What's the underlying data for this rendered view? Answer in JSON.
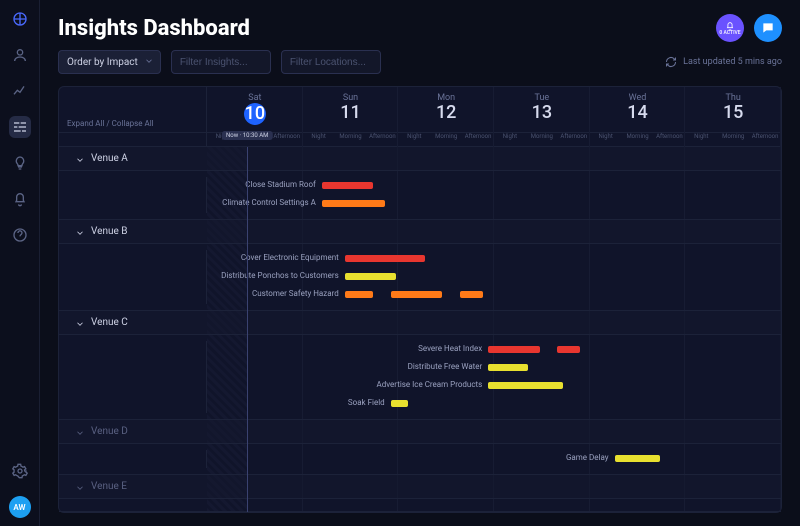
{
  "app": {
    "title": "Insights Dashboard"
  },
  "header_icons": {
    "notif_label": "0 ACTIVE"
  },
  "controls": {
    "order_label": "Order by Impact",
    "filter_insights_ph": "Filter Insights...",
    "filter_locations_ph": "Filter Locations...",
    "refresh_label": "Last updated 5 mins ago"
  },
  "timeline": {
    "expand_label": "Expand All / Collapse All",
    "now_label": "Now",
    "now_time": "10:30 AM",
    "subslots": [
      "Night",
      "Morning",
      "Afternoon",
      "Night",
      "Morning",
      "Afternoon",
      "Night",
      "Morning",
      "Afternoon",
      "Night",
      "Morning",
      "Afternoon",
      "Night",
      "Morning",
      "Afternoon",
      "Night",
      "Morning",
      "Afternoon"
    ],
    "days": [
      {
        "dow": "Sat",
        "num": "10",
        "current": true
      },
      {
        "dow": "Sun",
        "num": "11"
      },
      {
        "dow": "Mon",
        "num": "12"
      },
      {
        "dow": "Tue",
        "num": "13"
      },
      {
        "dow": "Wed",
        "num": "14"
      },
      {
        "dow": "Thu",
        "num": "15"
      }
    ],
    "now_pct": 7,
    "venues": [
      {
        "name": "Venue A",
        "open": true,
        "insights": [
          {
            "label": "Close Stadium Roof",
            "bars": [
              {
                "start": 20,
                "width": 9,
                "color": "red"
              }
            ]
          },
          {
            "label": "Climate Control Settings A",
            "bars": [
              {
                "start": 20,
                "width": 11,
                "color": "orange"
              }
            ]
          }
        ]
      },
      {
        "name": "Venue B",
        "open": true,
        "insights": [
          {
            "label": "Cover Electronic Equipment",
            "bars": [
              {
                "start": 24,
                "width": 14,
                "color": "red"
              }
            ]
          },
          {
            "label": "Distribute Ponchos to Customers",
            "bars": [
              {
                "start": 24,
                "width": 9,
                "color": "yellow"
              }
            ]
          },
          {
            "label": "Customer Safety Hazard",
            "bars": [
              {
                "start": 24,
                "width": 5,
                "color": "orange"
              },
              {
                "start": 32,
                "width": 9,
                "color": "orange"
              },
              {
                "start": 44,
                "width": 4,
                "color": "orange"
              }
            ]
          }
        ]
      },
      {
        "name": "Venue C",
        "open": true,
        "insights": [
          {
            "label": "Severe Heat Index",
            "bars": [
              {
                "start": 49,
                "width": 9,
                "color": "red"
              },
              {
                "start": 61,
                "width": 4,
                "color": "red"
              }
            ]
          },
          {
            "label": "Distribute Free Water",
            "bars": [
              {
                "start": 49,
                "width": 7,
                "color": "yellow"
              }
            ]
          },
          {
            "label": "Advertise Ice Cream Products",
            "bars": [
              {
                "start": 49,
                "width": 13,
                "color": "yellow"
              }
            ]
          },
          {
            "label": "Soak Field",
            "bars": [
              {
                "start": 32,
                "width": 3,
                "color": "yellow"
              }
            ]
          }
        ]
      },
      {
        "name": "Venue D",
        "open": false,
        "insights": [
          {
            "label": "Game Delay",
            "bars": [
              {
                "start": 71,
                "width": 8,
                "color": "yellow"
              }
            ]
          }
        ]
      },
      {
        "name": "Venue E",
        "open": false,
        "insights": []
      }
    ]
  },
  "avatar": "AW"
}
